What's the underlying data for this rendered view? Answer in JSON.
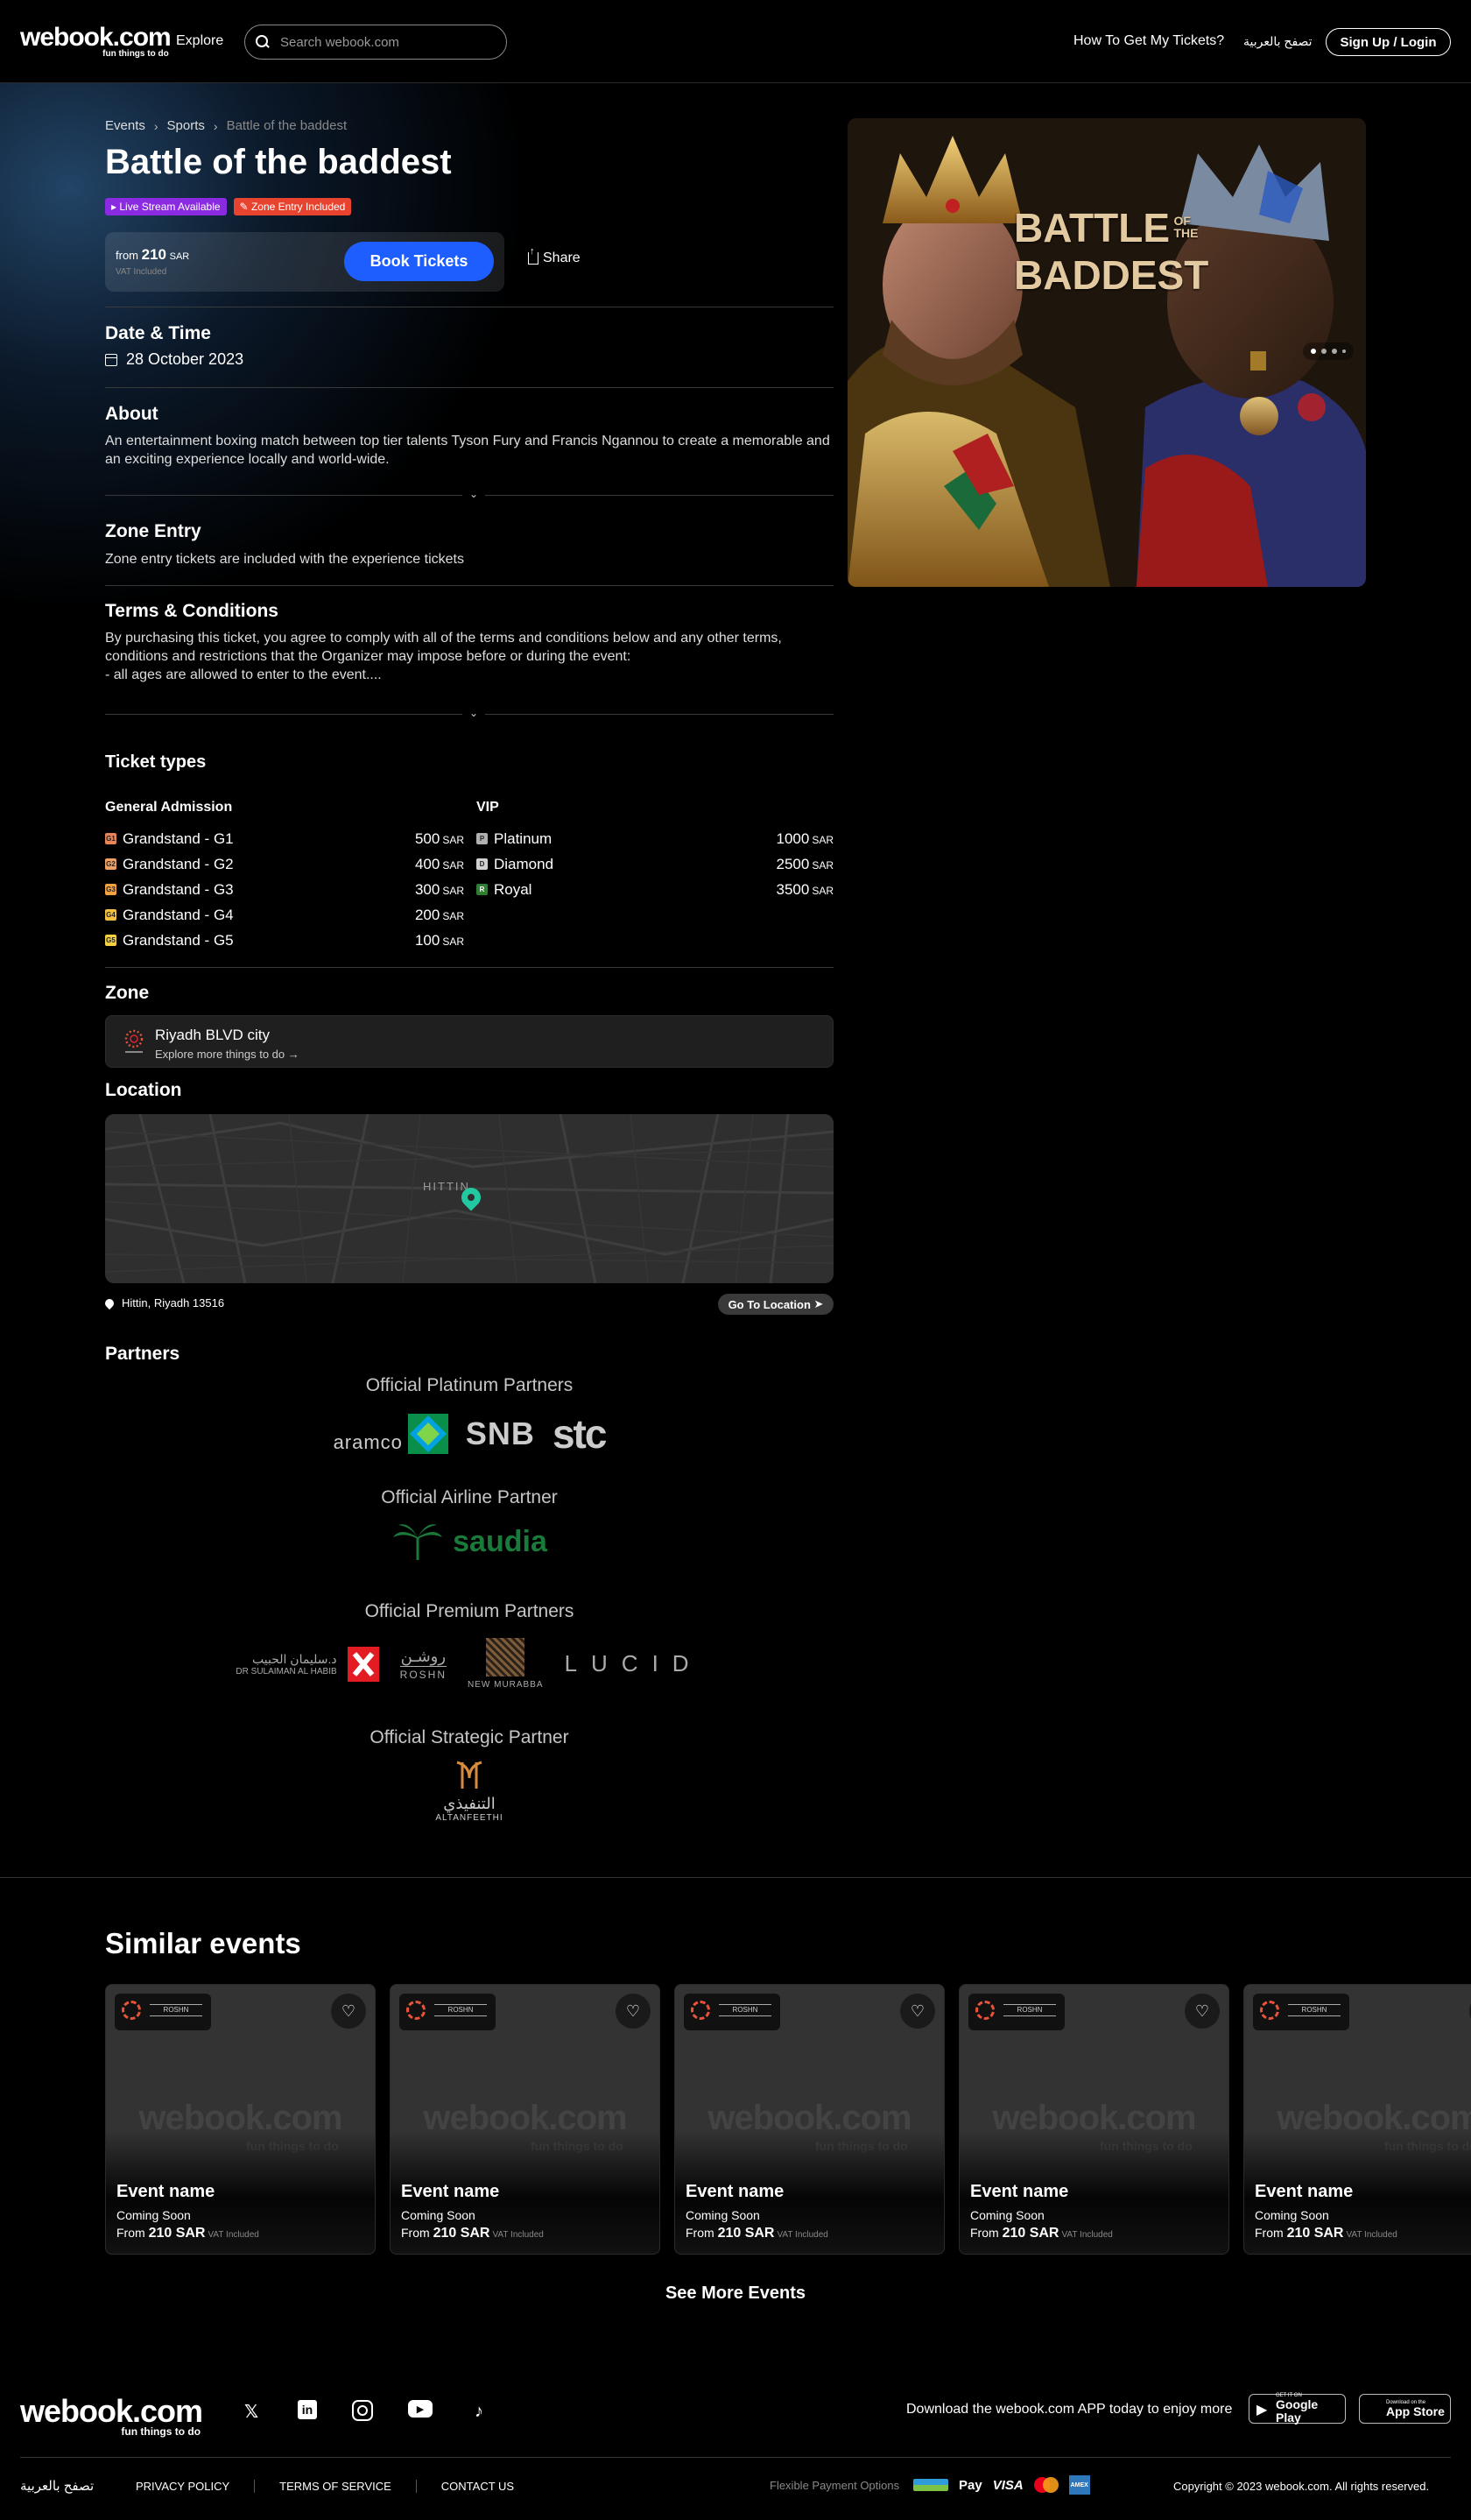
{
  "header": {
    "logo": "webook.com",
    "logo_tagline": "fun things to do",
    "explore": "Explore",
    "search_placeholder": "Search webook.com",
    "how_to": "How To Get My Tickets?",
    "lang": "تصفح بالعربية",
    "login": "Sign Up / Login"
  },
  "breadcrumb": [
    "Events",
    "Sports",
    "Battle of the baddest"
  ],
  "event": {
    "title": "Battle of the baddest",
    "badges": [
      {
        "label": "Live Stream Available",
        "color": "#8a2be2"
      },
      {
        "label": "Zone Entry Included",
        "color": "#e8432e"
      }
    ],
    "price_from": "from",
    "price": "210",
    "currency": "SAR",
    "vat": "VAT Included",
    "book": "Book Tickets",
    "share": "Share",
    "poster_title_1": "BATTLE",
    "poster_title_of": "OF THE",
    "poster_title_2": "BADDEST"
  },
  "date_section": {
    "heading": "Date & Time",
    "value": "28 October 2023"
  },
  "about": {
    "heading": "About",
    "text": "An entertainment boxing match between top tier talents Tyson Fury and Francis Ngannou to create a memorable and an exciting experience locally and world-wide."
  },
  "zone_entry": {
    "heading": "Zone Entry",
    "text": "Zone entry tickets are included with the experience tickets"
  },
  "terms": {
    "heading": "Terms & Conditions",
    "line1": "By purchasing this ticket, you agree to comply with all of the terms and conditions below and any other terms, conditions and restrictions that the Organizer may impose before or during the event:",
    "line2": "- all ages are allowed to enter to the event...."
  },
  "tickets": {
    "heading": "Ticket types",
    "groups": [
      {
        "name": "General Admission",
        "items": [
          {
            "code": "G1",
            "name": "Grandstand - G1",
            "price": "500",
            "color": "#e7845a"
          },
          {
            "code": "G2",
            "name": "Grandstand - G2",
            "price": "400",
            "color": "#f0a060"
          },
          {
            "code": "G3",
            "name": "Grandstand - G3",
            "price": "300",
            "color": "#f2a040"
          },
          {
            "code": "G4",
            "name": "Grandstand - G4",
            "price": "200",
            "color": "#f5c040"
          },
          {
            "code": "G5",
            "name": "Grandstand - G5",
            "price": "100",
            "color": "#f5d040"
          }
        ]
      },
      {
        "name": "VIP",
        "items": [
          {
            "code": "P",
            "name": "Platinum",
            "price": "1000",
            "color": "#b0b0b0"
          },
          {
            "code": "D",
            "name": "Diamond",
            "price": "2500",
            "color": "#d0d0d0"
          },
          {
            "code": "R",
            "name": "Royal",
            "price": "3500",
            "color": "#2e7d32"
          }
        ]
      }
    ],
    "currency": "SAR"
  },
  "zone": {
    "heading": "Zone",
    "name": "Riyadh BLVD city",
    "link": "Explore more things to do →"
  },
  "location": {
    "heading": "Location",
    "map_label": "HITTIN",
    "address": "Hittin, Riyadh 13516",
    "go": "Go To Location"
  },
  "partners": {
    "heading": "Partners",
    "categories": [
      {
        "title": "Official Platinum Partners",
        "logos": [
          "aramco",
          "SNB",
          "stc"
        ]
      },
      {
        "title": "Official Airline Partner",
        "logos": [
          "saudia"
        ]
      },
      {
        "title": "Official Premium Partners",
        "logos": [
          "DR SULAIMAN AL HABIB",
          "ROSHN",
          "NEW MURABBA",
          "LUCID"
        ]
      },
      {
        "title": "Official Strategic Partner",
        "logos": [
          "ALTANFEETHI"
        ]
      }
    ]
  },
  "similar": {
    "heading": "Similar events",
    "cards": [
      {
        "name": "Event name",
        "status": "Coming Soon",
        "from": "From",
        "price": "210 SAR",
        "vat": "VAT Included"
      },
      {
        "name": "Event name",
        "status": "Coming Soon",
        "from": "From",
        "price": "210 SAR",
        "vat": "VAT Included"
      },
      {
        "name": "Event name",
        "status": "Coming Soon",
        "from": "From",
        "price": "210 SAR",
        "vat": "VAT Included"
      },
      {
        "name": "Event name",
        "status": "Coming Soon",
        "from": "From",
        "price": "210 SAR",
        "vat": "VAT Included"
      },
      {
        "name": "Event name",
        "status": "Coming Soon",
        "from": "From",
        "price": "210 SAR",
        "vat": "VAT Included"
      }
    ],
    "see_more": "See More Events"
  },
  "footer": {
    "app_text": "Download the webook.com APP today to enjoy more",
    "google_small": "GET IT ON",
    "google": "Google Play",
    "apple_small": "Download on the",
    "apple": "App Store",
    "lang": "تصفح بالعربية",
    "links": [
      "PRIVACY POLICY",
      "TERMS OF SERVICE",
      "CONTACT US"
    ],
    "payment_label": "Flexible Payment Options",
    "copyright": "Copyright © 2023 webook.com. All rights reserved."
  }
}
